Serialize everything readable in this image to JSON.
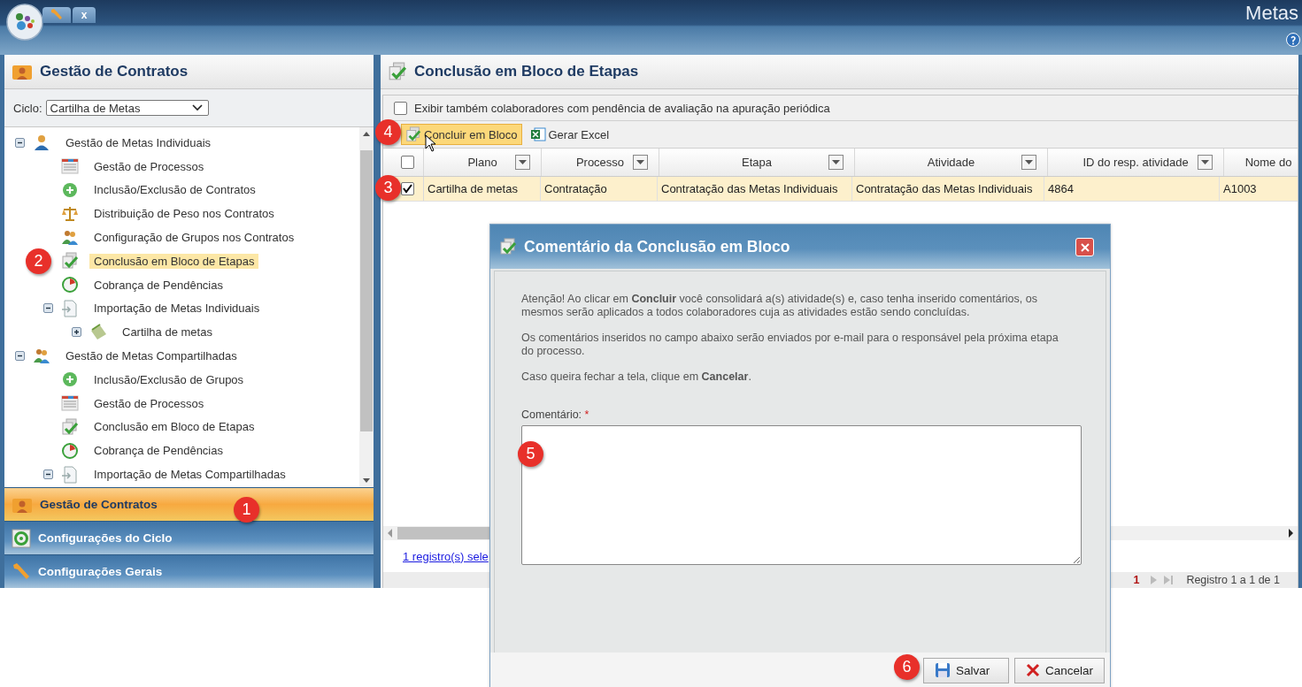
{
  "app_bar": {
    "tab_close": "x",
    "title": "Metas"
  },
  "left_panel": {
    "title": "Gestão de Contratos",
    "cycle": {
      "label": "Ciclo:",
      "value": "Cartilha de Metas"
    },
    "tree": [
      {
        "label": "Gestão de Metas Individuais",
        "kind": "person",
        "expanded": true,
        "selected": false,
        "children": [
          {
            "label": "Gestão de Processos",
            "kind": "list",
            "selected": false
          },
          {
            "label": "Inclusão/Exclusão de Contratos",
            "kind": "plus",
            "selected": false
          },
          {
            "label": "Distribuição de Peso nos Contratos",
            "kind": "scales",
            "selected": false
          },
          {
            "label": "Configuração de Grupos nos Contratos",
            "kind": "group",
            "selected": false
          },
          {
            "label": "Conclusão em Bloco de Etapas",
            "kind": "check",
            "selected": true
          },
          {
            "label": "Cobrança de Pendências",
            "kind": "clock",
            "selected": false
          },
          {
            "label": "Importação de Metas Individuais",
            "kind": "import",
            "expanded": true,
            "selected": false,
            "children": [
              {
                "label": "Cartilha de metas",
                "kind": "notebook",
                "expanded": false,
                "selected": false
              }
            ]
          }
        ]
      },
      {
        "label": "Gestão de Metas Compartilhadas",
        "kind": "group",
        "expanded": true,
        "selected": false,
        "children": [
          {
            "label": "Inclusão/Exclusão de Grupos",
            "kind": "plus",
            "selected": false
          },
          {
            "label": "Gestão de Processos",
            "kind": "list",
            "selected": false
          },
          {
            "label": "Conclusão em Bloco de Etapas",
            "kind": "check",
            "selected": false
          },
          {
            "label": "Cobrança de Pendências",
            "kind": "clock",
            "selected": false
          },
          {
            "label": "Importação de Metas Compartilhadas",
            "kind": "import",
            "expanded": true,
            "selected": false
          }
        ]
      }
    ],
    "accordion": [
      {
        "label": "Gestão de Contratos",
        "kind": "contracts",
        "selected": true
      },
      {
        "label": "Configurações do Ciclo",
        "kind": "cycle",
        "selected": false
      },
      {
        "label": "Configurações Gerais",
        "kind": "wrench",
        "selected": false
      }
    ]
  },
  "main_panel": {
    "title": "Conclusão em Bloco de Etapas",
    "option": {
      "label": "Exibir também colaboradores com pendência de avaliação na apuração periódica",
      "checked": false
    },
    "toolbar": [
      {
        "label": "Concluir em Bloco",
        "kind": "check",
        "hovered": true
      },
      {
        "label": "Gerar Excel",
        "kind": "excel",
        "hovered": false
      }
    ],
    "table": {
      "select_all": false,
      "columns": [
        "Plano",
        "Processo",
        "Etapa",
        "Atividade",
        "ID do resp. atividade",
        "Nome do"
      ],
      "rows": [
        {
          "checked": true,
          "cells": [
            "Cartilha de metas",
            "Contratação",
            "Contratação das Metas Individuais",
            "Contratação das Metas Individuais",
            "4864",
            "A1003"
          ]
        }
      ]
    },
    "selection_link": "1 registro(s) sele",
    "pager": {
      "page": "1",
      "summary": "Registro 1 a 1 de 1"
    }
  },
  "dialog": {
    "title": "Comentário da Conclusão em Bloco",
    "paragraphs": [
      "Atenção! Ao clicar em **Concluir** você consolidará a(s) atividade(s) e, caso tenha inserido comentários, os mesmos serão aplicados a todos colaboradores cuja as atividades estão sendo concluídas.",
      "Os comentários inseridos no campo abaixo serão enviados por e-mail para o responsável pela próxima etapa do processo.",
      "Caso queira fechar a tela, clique em **Cancelar**."
    ],
    "comment_label": "Comentário:",
    "required_mark": "*",
    "buttons": [
      {
        "label": "Salvar",
        "kind": "save"
      },
      {
        "label": "Cancelar",
        "kind": "cancel"
      }
    ]
  },
  "callouts": [
    "1",
    "2",
    "3",
    "4",
    "5",
    "6"
  ]
}
